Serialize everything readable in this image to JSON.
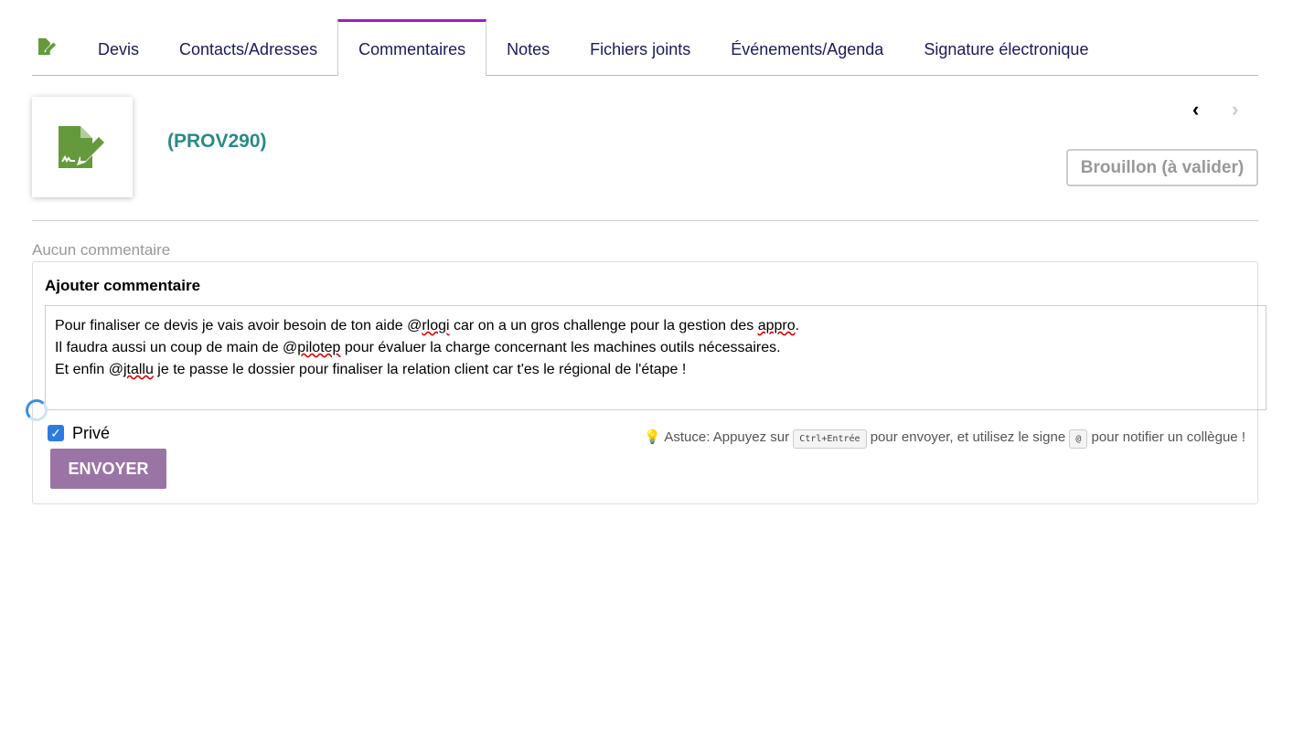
{
  "tabs": [
    "Devis",
    "Contacts/Adresses",
    "Commentaires",
    "Notes",
    "Fichiers joints",
    "Événements/Agenda",
    "Signature électronique"
  ],
  "active_tab": "Commentaires",
  "colors": {
    "accent": "#a21cc0",
    "icon_green": "#659a3c",
    "ref": "#2a8a87",
    "send": "#9b74a6"
  },
  "record": {
    "ref": "(PROV290)",
    "status": "Brouillon (à valider)",
    "prev_icon": "‹",
    "next_icon": "›"
  },
  "comments": {
    "empty": "Aucun commentaire",
    "add_title": "Ajouter commentaire",
    "text_lines": [
      [
        "Pour finaliser ce devis je vais avoir besoin de ton aide @",
        "rlogi",
        " car on a un gros challenge pour la gestion des ",
        "appro",
        "."
      ],
      [
        "Il faudra aussi un coup de main de @",
        "pilotep",
        " pour évaluer la charge concernant les machines outils nécessaires."
      ],
      [
        "Et enfin @",
        "jtallu",
        " je te passe le dossier pour finaliser la relation client car t'es le régional de l'étape !"
      ]
    ],
    "private_label": "Privé",
    "private_checked": true,
    "tip": {
      "icon": "💡",
      "a": "Astuce: Appuyez sur",
      "key1": "Ctrl+Entrée",
      "b": "pour envoyer, et utilisez le signe",
      "key2": "@",
      "c": "pour notifier un collègue !"
    },
    "send": "ENVOYER"
  }
}
